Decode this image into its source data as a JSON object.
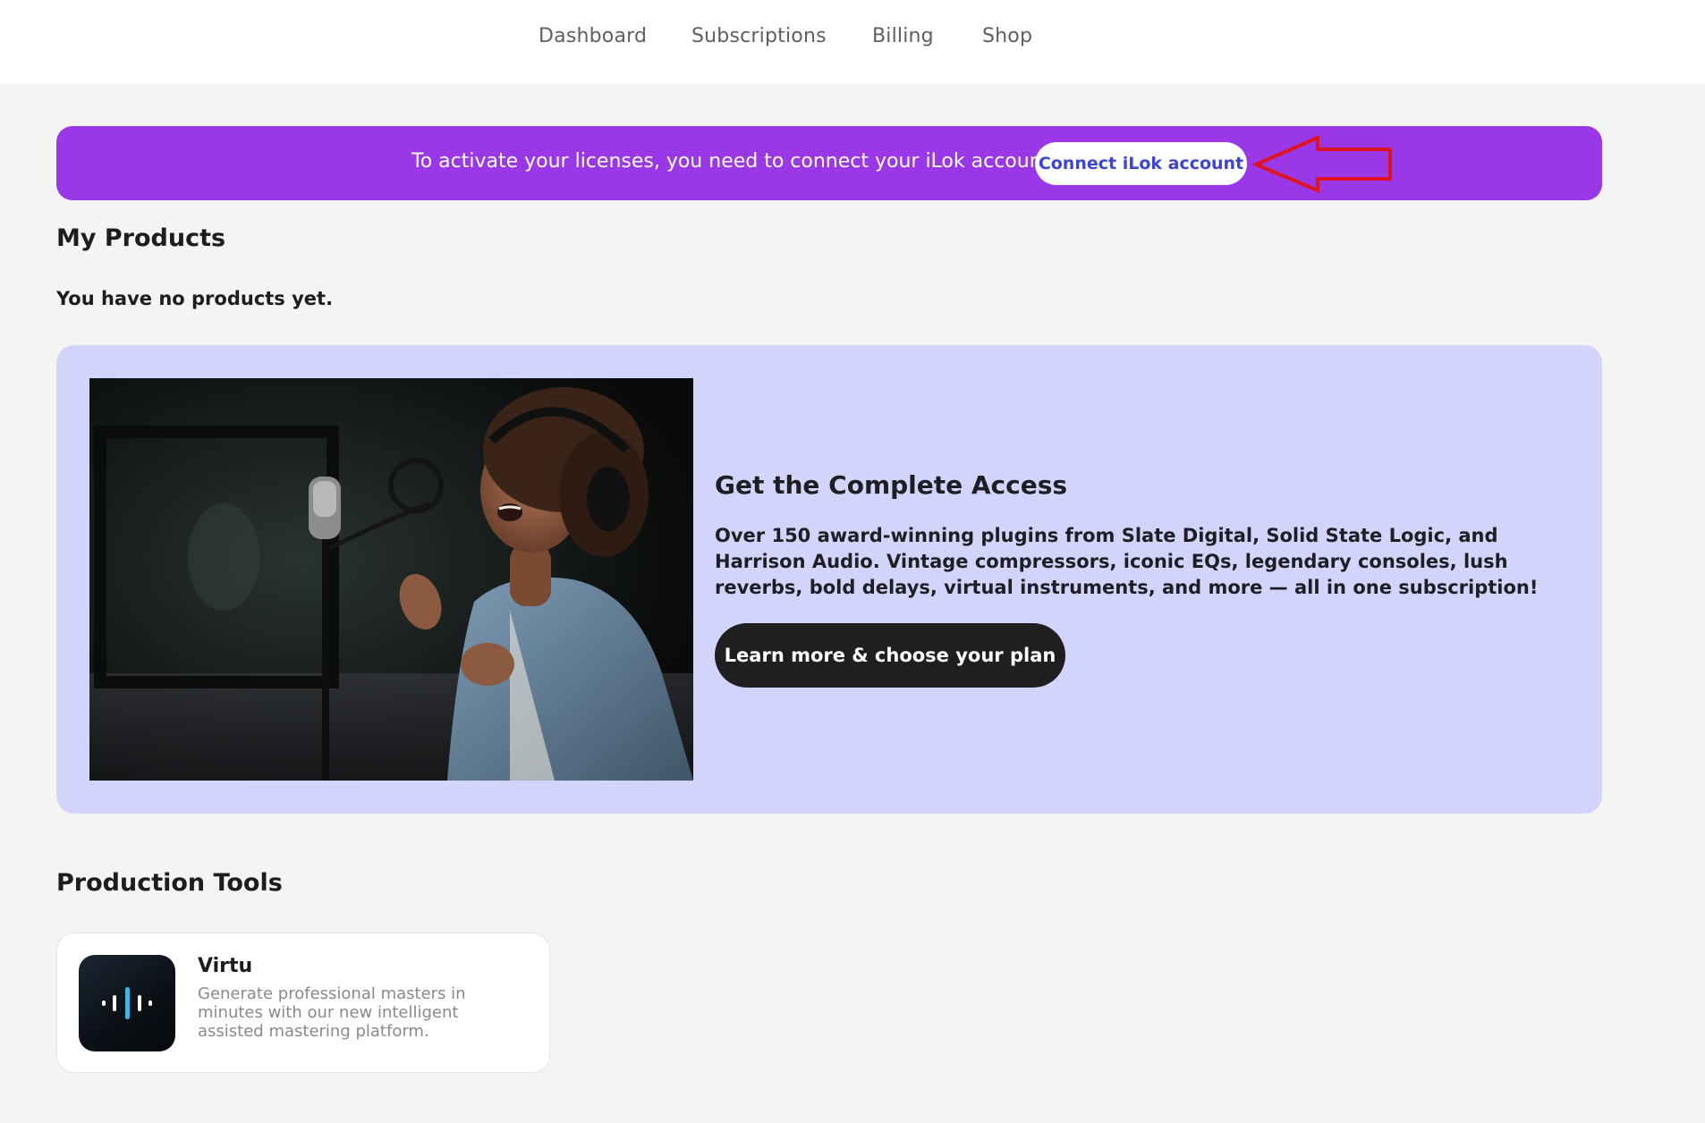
{
  "nav": {
    "items": [
      {
        "label": "Dashboard"
      },
      {
        "label": "Subscriptions"
      },
      {
        "label": "Billing"
      },
      {
        "label": "Shop"
      }
    ]
  },
  "ilok_banner": {
    "message": "To activate your licenses, you need to connect your iLok account.",
    "button_label": "Connect iLok account",
    "background_color": "#9a37e6",
    "button_text_color": "#3d46d4"
  },
  "my_products": {
    "title": "My Products",
    "empty_message": "You have no products yet."
  },
  "promo": {
    "image_icon": "singer-in-studio-photo",
    "heading": "Get the Complete Access",
    "description": "Over 150 award-winning plugins from Slate Digital, Solid State Logic, and Harrison Audio. Vintage compressors, iconic EQs, legendary consoles, lush reverbs, bold delays, virtual instruments, and more — all in one subscription!",
    "button_label": "Learn more & choose your plan",
    "background_color": "#d3d4fb"
  },
  "production_tools": {
    "title": "Production Tools",
    "tools": [
      {
        "name": "Virtu",
        "icon": "waveform-icon",
        "description": "Generate professional masters in minutes with our new intelligent assisted mastering platform."
      }
    ]
  },
  "annotation": {
    "icon": "red-arrow-annotation",
    "color": "#e0141e"
  }
}
